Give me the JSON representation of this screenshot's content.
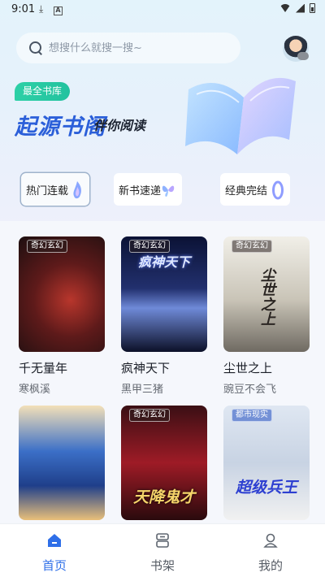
{
  "status_bar": {
    "time": "9:01"
  },
  "search": {
    "placeholder": "想搜什么就搜一搜~"
  },
  "hero": {
    "badge": "最全书库",
    "brand": "起源书阁",
    "slogan": "伴你阅读"
  },
  "categories": [
    {
      "label": "热门连载",
      "active": true
    },
    {
      "label": "新书速递",
      "active": false
    },
    {
      "label": "经典完结",
      "active": false
    }
  ],
  "books": [
    {
      "title": "千无量年",
      "author": "寒枫溪",
      "genre": "奇幻玄幻",
      "cover_text": ""
    },
    {
      "title": "疯神天下",
      "author": "黑甲三猪",
      "genre": "奇幻玄幻",
      "cover_text": "疯神天下"
    },
    {
      "title": "尘世之上",
      "author": "豌豆不会飞",
      "genre": "奇幻玄幻",
      "cover_text": "尘世之上"
    },
    {
      "title": "",
      "author": "",
      "genre": "",
      "cover_text": ""
    },
    {
      "title": "",
      "author": "",
      "genre": "奇幻玄幻",
      "cover_text": "天降鬼才"
    },
    {
      "title": "",
      "author": "",
      "genre": "都市现实",
      "cover_text": "超级兵王"
    }
  ],
  "bottom_nav": [
    {
      "label": "首页",
      "icon": "home-icon",
      "active": true
    },
    {
      "label": "书架",
      "icon": "bookshelf-icon",
      "active": false
    },
    {
      "label": "我的",
      "icon": "profile-icon",
      "active": false
    }
  ],
  "colors": {
    "accent": "#2f6fe8",
    "brand": "#2b5fd9",
    "badge": "#25c7a2"
  }
}
